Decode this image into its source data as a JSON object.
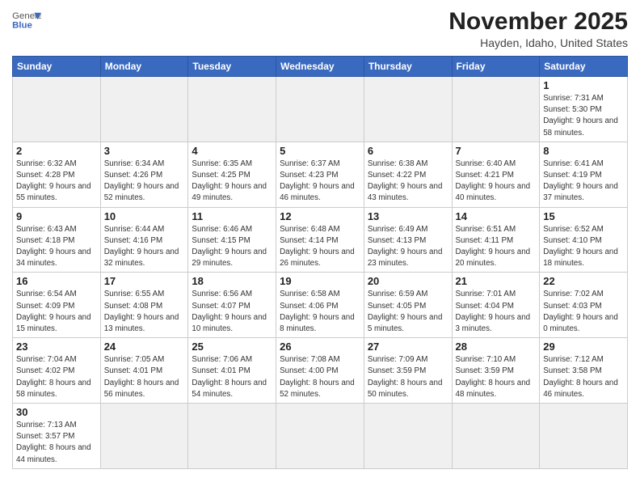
{
  "header": {
    "logo_general": "General",
    "logo_blue": "Blue",
    "title": "November 2025",
    "subtitle": "Hayden, Idaho, United States"
  },
  "weekdays": [
    "Sunday",
    "Monday",
    "Tuesday",
    "Wednesday",
    "Thursday",
    "Friday",
    "Saturday"
  ],
  "days": [
    {
      "date": "",
      "sunrise": "",
      "sunset": "",
      "daylight": "",
      "empty": true
    },
    {
      "date": "",
      "sunrise": "",
      "sunset": "",
      "daylight": "",
      "empty": true
    },
    {
      "date": "",
      "sunrise": "",
      "sunset": "",
      "daylight": "",
      "empty": true
    },
    {
      "date": "",
      "sunrise": "",
      "sunset": "",
      "daylight": "",
      "empty": true
    },
    {
      "date": "",
      "sunrise": "",
      "sunset": "",
      "daylight": "",
      "empty": true
    },
    {
      "date": "",
      "sunrise": "",
      "sunset": "",
      "daylight": "",
      "empty": true
    },
    {
      "date": "1",
      "sunrise": "Sunrise: 7:31 AM",
      "sunset": "Sunset: 5:30 PM",
      "daylight": "Daylight: 9 hours and 58 minutes.",
      "empty": false
    },
    {
      "date": "2",
      "sunrise": "Sunrise: 6:32 AM",
      "sunset": "Sunset: 4:28 PM",
      "daylight": "Daylight: 9 hours and 55 minutes.",
      "empty": false
    },
    {
      "date": "3",
      "sunrise": "Sunrise: 6:34 AM",
      "sunset": "Sunset: 4:26 PM",
      "daylight": "Daylight: 9 hours and 52 minutes.",
      "empty": false
    },
    {
      "date": "4",
      "sunrise": "Sunrise: 6:35 AM",
      "sunset": "Sunset: 4:25 PM",
      "daylight": "Daylight: 9 hours and 49 minutes.",
      "empty": false
    },
    {
      "date": "5",
      "sunrise": "Sunrise: 6:37 AM",
      "sunset": "Sunset: 4:23 PM",
      "daylight": "Daylight: 9 hours and 46 minutes.",
      "empty": false
    },
    {
      "date": "6",
      "sunrise": "Sunrise: 6:38 AM",
      "sunset": "Sunset: 4:22 PM",
      "daylight": "Daylight: 9 hours and 43 minutes.",
      "empty": false
    },
    {
      "date": "7",
      "sunrise": "Sunrise: 6:40 AM",
      "sunset": "Sunset: 4:21 PM",
      "daylight": "Daylight: 9 hours and 40 minutes.",
      "empty": false
    },
    {
      "date": "8",
      "sunrise": "Sunrise: 6:41 AM",
      "sunset": "Sunset: 4:19 PM",
      "daylight": "Daylight: 9 hours and 37 minutes.",
      "empty": false
    },
    {
      "date": "9",
      "sunrise": "Sunrise: 6:43 AM",
      "sunset": "Sunset: 4:18 PM",
      "daylight": "Daylight: 9 hours and 34 minutes.",
      "empty": false
    },
    {
      "date": "10",
      "sunrise": "Sunrise: 6:44 AM",
      "sunset": "Sunset: 4:16 PM",
      "daylight": "Daylight: 9 hours and 32 minutes.",
      "empty": false
    },
    {
      "date": "11",
      "sunrise": "Sunrise: 6:46 AM",
      "sunset": "Sunset: 4:15 PM",
      "daylight": "Daylight: 9 hours and 29 minutes.",
      "empty": false
    },
    {
      "date": "12",
      "sunrise": "Sunrise: 6:48 AM",
      "sunset": "Sunset: 4:14 PM",
      "daylight": "Daylight: 9 hours and 26 minutes.",
      "empty": false
    },
    {
      "date": "13",
      "sunrise": "Sunrise: 6:49 AM",
      "sunset": "Sunset: 4:13 PM",
      "daylight": "Daylight: 9 hours and 23 minutes.",
      "empty": false
    },
    {
      "date": "14",
      "sunrise": "Sunrise: 6:51 AM",
      "sunset": "Sunset: 4:11 PM",
      "daylight": "Daylight: 9 hours and 20 minutes.",
      "empty": false
    },
    {
      "date": "15",
      "sunrise": "Sunrise: 6:52 AM",
      "sunset": "Sunset: 4:10 PM",
      "daylight": "Daylight: 9 hours and 18 minutes.",
      "empty": false
    },
    {
      "date": "16",
      "sunrise": "Sunrise: 6:54 AM",
      "sunset": "Sunset: 4:09 PM",
      "daylight": "Daylight: 9 hours and 15 minutes.",
      "empty": false
    },
    {
      "date": "17",
      "sunrise": "Sunrise: 6:55 AM",
      "sunset": "Sunset: 4:08 PM",
      "daylight": "Daylight: 9 hours and 13 minutes.",
      "empty": false
    },
    {
      "date": "18",
      "sunrise": "Sunrise: 6:56 AM",
      "sunset": "Sunset: 4:07 PM",
      "daylight": "Daylight: 9 hours and 10 minutes.",
      "empty": false
    },
    {
      "date": "19",
      "sunrise": "Sunrise: 6:58 AM",
      "sunset": "Sunset: 4:06 PM",
      "daylight": "Daylight: 9 hours and 8 minutes.",
      "empty": false
    },
    {
      "date": "20",
      "sunrise": "Sunrise: 6:59 AM",
      "sunset": "Sunset: 4:05 PM",
      "daylight": "Daylight: 9 hours and 5 minutes.",
      "empty": false
    },
    {
      "date": "21",
      "sunrise": "Sunrise: 7:01 AM",
      "sunset": "Sunset: 4:04 PM",
      "daylight": "Daylight: 9 hours and 3 minutes.",
      "empty": false
    },
    {
      "date": "22",
      "sunrise": "Sunrise: 7:02 AM",
      "sunset": "Sunset: 4:03 PM",
      "daylight": "Daylight: 9 hours and 0 minutes.",
      "empty": false
    },
    {
      "date": "23",
      "sunrise": "Sunrise: 7:04 AM",
      "sunset": "Sunset: 4:02 PM",
      "daylight": "Daylight: 8 hours and 58 minutes.",
      "empty": false
    },
    {
      "date": "24",
      "sunrise": "Sunrise: 7:05 AM",
      "sunset": "Sunset: 4:01 PM",
      "daylight": "Daylight: 8 hours and 56 minutes.",
      "empty": false
    },
    {
      "date": "25",
      "sunrise": "Sunrise: 7:06 AM",
      "sunset": "Sunset: 4:01 PM",
      "daylight": "Daylight: 8 hours and 54 minutes.",
      "empty": false
    },
    {
      "date": "26",
      "sunrise": "Sunrise: 7:08 AM",
      "sunset": "Sunset: 4:00 PM",
      "daylight": "Daylight: 8 hours and 52 minutes.",
      "empty": false
    },
    {
      "date": "27",
      "sunrise": "Sunrise: 7:09 AM",
      "sunset": "Sunset: 3:59 PM",
      "daylight": "Daylight: 8 hours and 50 minutes.",
      "empty": false
    },
    {
      "date": "28",
      "sunrise": "Sunrise: 7:10 AM",
      "sunset": "Sunset: 3:59 PM",
      "daylight": "Daylight: 8 hours and 48 minutes.",
      "empty": false
    },
    {
      "date": "29",
      "sunrise": "Sunrise: 7:12 AM",
      "sunset": "Sunset: 3:58 PM",
      "daylight": "Daylight: 8 hours and 46 minutes.",
      "empty": false
    },
    {
      "date": "30",
      "sunrise": "Sunrise: 7:13 AM",
      "sunset": "Sunset: 3:57 PM",
      "daylight": "Daylight: 8 hours and 44 minutes.",
      "empty": false
    },
    {
      "date": "",
      "sunrise": "",
      "sunset": "",
      "daylight": "",
      "empty": true
    },
    {
      "date": "",
      "sunrise": "",
      "sunset": "",
      "daylight": "",
      "empty": true
    },
    {
      "date": "",
      "sunrise": "",
      "sunset": "",
      "daylight": "",
      "empty": true
    },
    {
      "date": "",
      "sunrise": "",
      "sunset": "",
      "daylight": "",
      "empty": true
    },
    {
      "date": "",
      "sunrise": "",
      "sunset": "",
      "daylight": "",
      "empty": true
    },
    {
      "date": "",
      "sunrise": "",
      "sunset": "",
      "daylight": "",
      "empty": true
    }
  ]
}
